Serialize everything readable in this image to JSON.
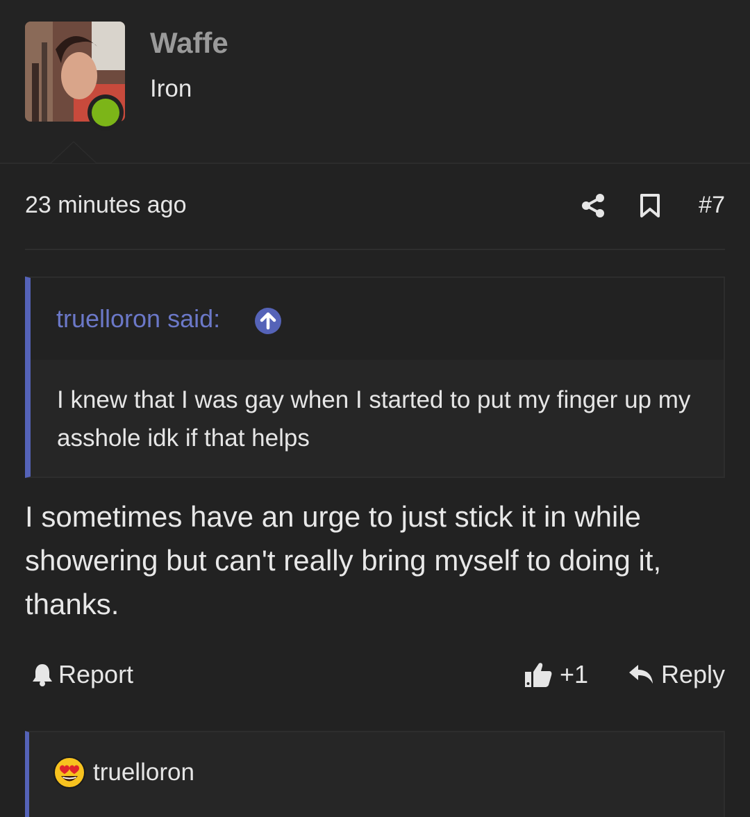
{
  "user": {
    "name": "Waffe",
    "title": "Iron",
    "status_color": "#7cb518"
  },
  "post": {
    "timestamp": "23 minutes ago",
    "number": "#7",
    "body": "I sometimes have an urge to just stick it in while showering but can't really bring myself to doing it, thanks."
  },
  "quote": {
    "author_label": "truelloron said:",
    "text": "I knew that I was gay when I started to put my finger up my asshole idk if that helps",
    "accent_color": "#5563b8"
  },
  "actions": {
    "report_label": "Report",
    "like_label": "+1",
    "reply_label": "Reply"
  },
  "reactions": {
    "items": [
      {
        "emoji_icon": "heart-eyes-emoji-icon",
        "name": "truelloron"
      }
    ]
  }
}
